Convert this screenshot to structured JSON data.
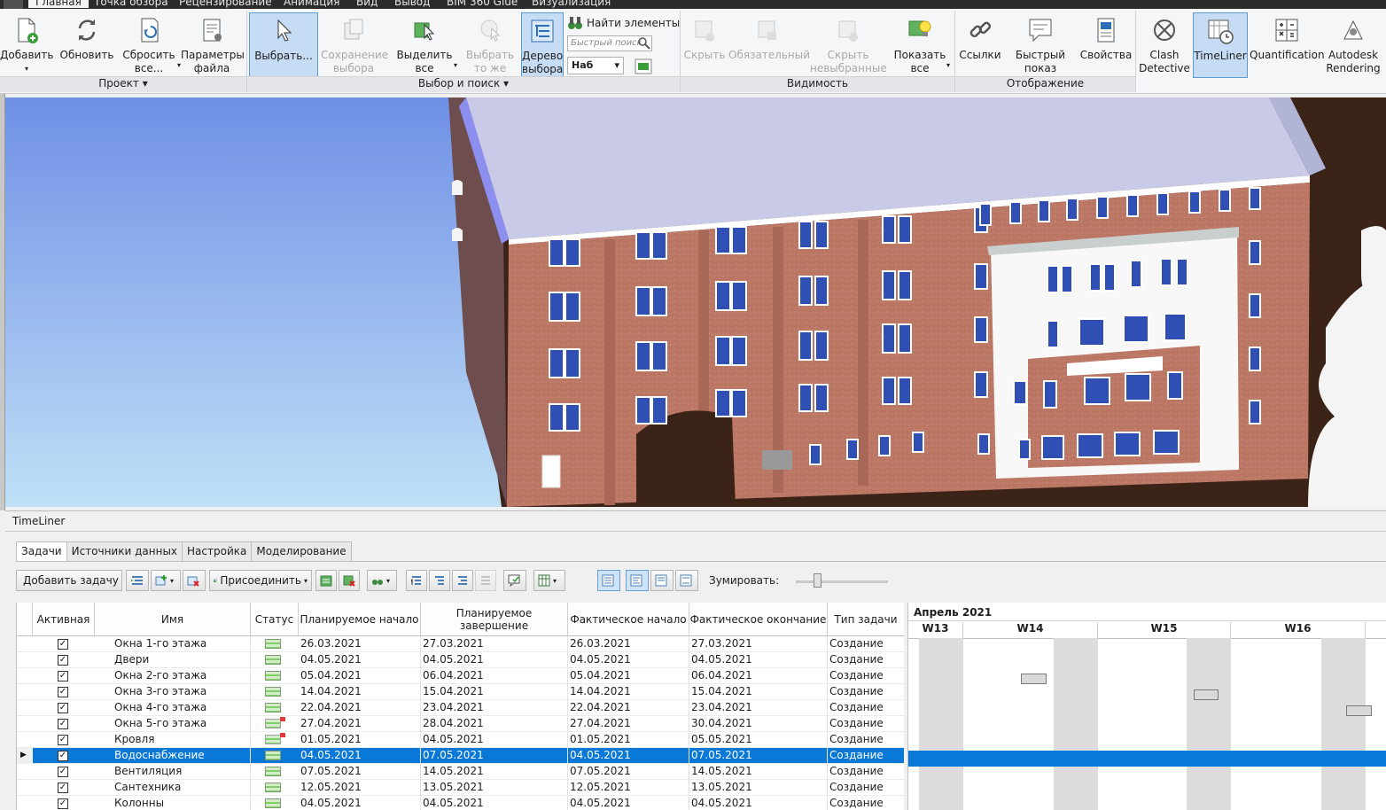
{
  "menu": {
    "items": [
      "Главная",
      "Точка обзора",
      "Рецензирование",
      "Анимация",
      "Вид",
      "Вывод",
      "BIM 360 Glue",
      "Визуализация"
    ],
    "active_index": 0
  },
  "ribbon": {
    "project": {
      "group_label": "Проект",
      "add": "Добавить",
      "refresh": "Обновить",
      "reset": "Сбросить\nвсе...",
      "file_options": "Параметры\nфайла"
    },
    "select": {
      "group_label": "Выбор и поиск",
      "select": "Выбрать...",
      "save_selection": "Сохранение\nвыбора",
      "select_all": "Выделить\nвсе",
      "select_same": "Выбрать\nто же",
      "selection_tree": "Дерево\nвыбора",
      "find_items": "Найти элементы",
      "quick_find_placeholder": "Быстрый поиск",
      "sets_value": "Наб"
    },
    "visibility": {
      "group_label": "Видимость",
      "hide": "Скрыть",
      "require": "Обязательный",
      "hide_unselected": "Скрыть\nневыбранные",
      "show_all": "Показать\nвсе"
    },
    "display": {
      "group_label": "Отображение",
      "links": "Ссылки",
      "quick_props": "Быстрый\nпоказ свойств",
      "properties": "Свойства"
    },
    "tools": {
      "clash": "Clash\nDetective",
      "timeliner": "TimeLiner",
      "quantification": "Quantification",
      "rendering": "Autodesk\nRendering"
    }
  },
  "timeliner": {
    "title": "TimeLiner",
    "tabs": [
      "Задачи",
      "Источники данных",
      "Настройка",
      "Моделирование"
    ],
    "active_tab": 0,
    "toolbar": {
      "add_task": "Добавить задачу",
      "attach": "Присоединить",
      "zoom_label": "Зумировать:"
    },
    "columns": [
      "Активная",
      "Имя",
      "Статус",
      "Планируемое начало",
      "Планируемое завершение",
      "Фактическое начало",
      "Фактическое окончание",
      "Тип задачи"
    ],
    "rows": [
      {
        "active": true,
        "name": "Окна 1-го этажа",
        "status": "ontime",
        "plan_start": "26.03.2021",
        "plan_end": "27.03.2021",
        "fact_start": "26.03.2021",
        "fact_end": "27.03.2021",
        "type": "Создание"
      },
      {
        "active": true,
        "name": "Двери",
        "status": "ontime",
        "plan_start": "04.05.2021",
        "plan_end": "04.05.2021",
        "fact_start": "04.05.2021",
        "fact_end": "04.05.2021",
        "type": "Создание"
      },
      {
        "active": true,
        "name": "Окна 2-го этажа",
        "status": "ontime",
        "plan_start": "05.04.2021",
        "plan_end": "06.04.2021",
        "fact_start": "05.04.2021",
        "fact_end": "06.04.2021",
        "type": "Создание"
      },
      {
        "active": true,
        "name": "Окна 3-го этажа",
        "status": "ontime",
        "plan_start": "14.04.2021",
        "plan_end": "15.04.2021",
        "fact_start": "14.04.2021",
        "fact_end": "15.04.2021",
        "type": "Создание"
      },
      {
        "active": true,
        "name": "Окна 4-го этажа",
        "status": "ontime",
        "plan_start": "22.04.2021",
        "plan_end": "23.04.2021",
        "fact_start": "22.04.2021",
        "fact_end": "23.04.2021",
        "type": "Создание"
      },
      {
        "active": true,
        "name": "Окна 5-го этажа",
        "status": "late",
        "plan_start": "27.04.2021",
        "plan_end": "28.04.2021",
        "fact_start": "27.04.2021",
        "fact_end": "30.04.2021",
        "type": "Создание"
      },
      {
        "active": true,
        "name": "Кровля",
        "status": "late",
        "plan_start": "01.05.2021",
        "plan_end": "04.05.2021",
        "fact_start": "01.05.2021",
        "fact_end": "05.05.2021",
        "type": "Создание"
      },
      {
        "active": true,
        "name": "Водоснабжение",
        "status": "ontime",
        "plan_start": "04.05.2021",
        "plan_end": "07.05.2021",
        "fact_start": "04.05.2021",
        "fact_end": "07.05.2021",
        "type": "Создание",
        "selected": true
      },
      {
        "active": true,
        "name": "Вентиляция",
        "status": "ontime",
        "plan_start": "07.05.2021",
        "plan_end": "14.05.2021",
        "fact_start": "07.05.2021",
        "fact_end": "14.05.2021",
        "type": "Создание"
      },
      {
        "active": true,
        "name": "Сантехника",
        "status": "ontime",
        "plan_start": "12.05.2021",
        "plan_end": "13.05.2021",
        "fact_start": "12.05.2021",
        "fact_end": "13.05.2021",
        "type": "Создание"
      },
      {
        "active": true,
        "name": "Колонны",
        "status": "ontime",
        "plan_start": "04.05.2021",
        "plan_end": "04.05.2021",
        "fact_start": "04.05.2021",
        "fact_end": "04.05.2021",
        "type": "Создание"
      }
    ],
    "gantt": {
      "month": "Апрель 2021",
      "weeks": [
        "W13",
        "W14",
        "W15",
        "W16"
      ]
    }
  },
  "colors": {
    "selection": "#0a78d7",
    "sky_top": "#6f8fe6",
    "brick": "#b4705f",
    "roof": "#c6c9e6",
    "window": "#2f4fb5"
  }
}
